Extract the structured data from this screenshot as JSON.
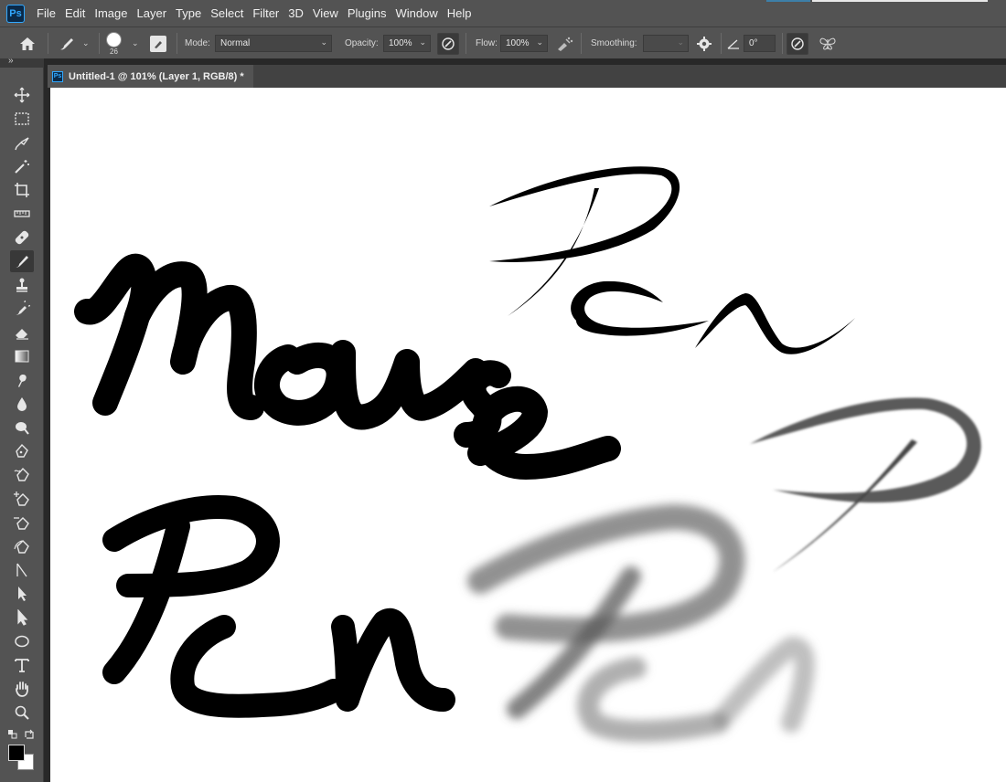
{
  "app": {
    "logo_text": "Ps"
  },
  "menu": [
    "File",
    "Edit",
    "Image",
    "Layer",
    "Type",
    "Select",
    "Filter",
    "3D",
    "View",
    "Plugins",
    "Window",
    "Help"
  ],
  "options": {
    "brush_size": "26",
    "mode_label": "Mode:",
    "mode_value": "Normal",
    "opacity_label": "Opacity:",
    "opacity_value": "100%",
    "flow_label": "Flow:",
    "flow_value": "100%",
    "smoothing_label": "Smoothing:",
    "smoothing_value": "",
    "angle_value": "0°"
  },
  "panel_toggle": "»",
  "document": {
    "app_badge": "Ps",
    "tab_title": "Untitled-1 @ 101% (Layer 1, RGB/8) *"
  },
  "tools": [
    "move-tool-icon",
    "rectangular-marquee-icon",
    "lasso-icon",
    "magic-wand-icon",
    "crop-icon",
    "ruler-icon",
    "healing-brush-icon",
    "brush-icon",
    "clone-stamp-icon",
    "history-brush-icon",
    "eraser-icon",
    "gradient-icon",
    "smudge-icon",
    "blur-icon",
    "dodge-icon",
    "pen-icon",
    "freeform-pen-icon",
    "add-anchor-icon",
    "delete-anchor-icon",
    "convert-point-icon",
    "path-selection-icon",
    "direct-selection-icon",
    "ellipse-icon",
    "type-icon",
    "hand-icon",
    "zoom-icon"
  ],
  "colors": {
    "foreground": "#000000",
    "background": "#ffffff",
    "ui_dark": "#535353",
    "accent": "#31a8ff"
  }
}
